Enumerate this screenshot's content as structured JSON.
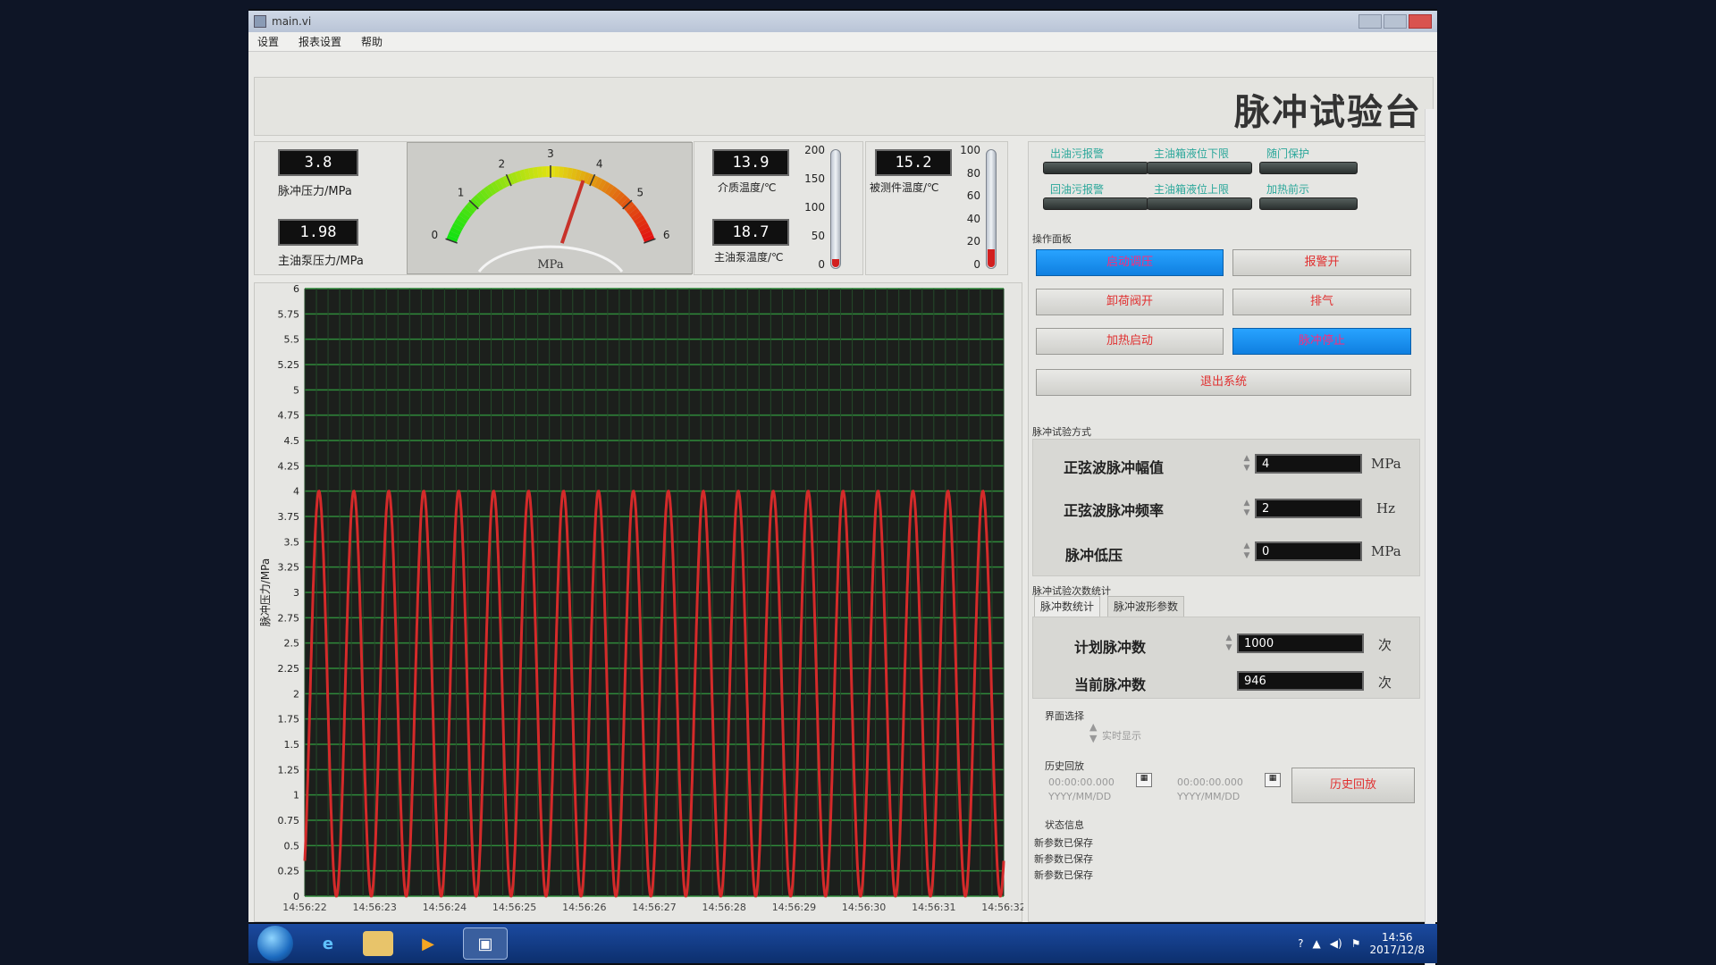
{
  "window": {
    "title": "main.vi"
  },
  "menu": [
    "设置",
    "报表设置",
    "帮助"
  ],
  "banner_title": "脉冲试验台",
  "readouts": {
    "pulse_pressure": {
      "value": "3.8",
      "label": "脉冲压力/MPa"
    },
    "main_pump_pressure": {
      "value": "1.98",
      "label": "主油泵压力/MPa"
    },
    "medium_temp": {
      "value": "13.9",
      "label": "介质温度/℃"
    },
    "main_pump_temp": {
      "value": "18.7",
      "label": "主油泵温度/℃"
    },
    "test_piece_temp": {
      "value": "15.2",
      "label": "被测件温度/℃"
    }
  },
  "gauge": {
    "ticks": [
      "0",
      "1",
      "2",
      "3",
      "4",
      "5",
      "6"
    ],
    "unit": "MPa",
    "value": 3.8,
    "min": 0,
    "max": 6
  },
  "thermo1": {
    "scale": [
      "200",
      "150",
      "100",
      "50",
      "0"
    ],
    "max": 200,
    "value": 13.9
  },
  "thermo2": {
    "scale": [
      "100",
      "80",
      "60",
      "40",
      "20",
      "0"
    ],
    "max": 100,
    "value": 15.2
  },
  "indicators": [
    "出油污报警",
    "主油箱液位下限",
    "随门保护",
    "回油污报警",
    "主油箱液位上限",
    "加热前示"
  ],
  "ops": {
    "title": "操作面板",
    "buttons": [
      "启动调压",
      "报警开",
      "卸荷阀开",
      "排气",
      "加热启动",
      "脉冲停止",
      "退出系统"
    ],
    "active": [
      0,
      5
    ]
  },
  "wave": {
    "title": "脉冲试验方式",
    "amplitude_label": "正弦波脉冲幅值",
    "amplitude_value": "4",
    "amplitude_unit": "MPa",
    "frequency_label": "正弦波脉冲频率",
    "frequency_value": "2",
    "frequency_unit": "Hz",
    "low_label": "脉冲低压",
    "low_value": "0",
    "low_unit": "MPa"
  },
  "count": {
    "title": "脉冲试验次数统计",
    "tabs": [
      "脉冲数统计",
      "脉冲波形参数"
    ],
    "planned_label": "计划脉冲数",
    "planned_value": "1000",
    "current_label": "当前脉冲数",
    "current_value": "946",
    "unit": "次"
  },
  "view": {
    "title": "界面选择",
    "option": "实时显示"
  },
  "history": {
    "title": "历史回放",
    "start_time": "00:00:00.000",
    "start_date": "YYYY/MM/DD",
    "end_time": "00:00:00.000",
    "end_date": "YYYY/MM/DD",
    "button": "历史回放"
  },
  "status": {
    "title": "状态信息",
    "lines": [
      "新参数已保存",
      "新参数已保存",
      "新参数已保存"
    ]
  },
  "taskbar": {
    "time": "14:56",
    "date": "2017/12/8"
  },
  "chart_data": {
    "type": "line",
    "ylabel": "脉冲压力/MPa",
    "ylim": [
      0,
      6
    ],
    "y_ticks": [
      "0",
      "0.25",
      "0.5",
      "0.75",
      "1",
      "1.25",
      "1.5",
      "1.75",
      "2",
      "2.25",
      "2.5",
      "2.75",
      "3",
      "3.25",
      "3.5",
      "3.75",
      "4",
      "4.25",
      "4.5",
      "4.75",
      "5",
      "5.25",
      "5.5",
      "5.75",
      "6"
    ],
    "x_ticks": [
      "14:56:22",
      "14:56:23",
      "14:56:24",
      "14:56:25",
      "14:56:26",
      "14:56:27",
      "14:56:28",
      "14:56:29",
      "14:56:30",
      "14:56:31",
      "14:56:32"
    ],
    "xlim_seconds": [
      0,
      10
    ],
    "series": [
      {
        "amplitude": 4,
        "offset": 0,
        "frequency_hz": 2,
        "color": "#d42a2a"
      }
    ],
    "grid": true,
    "background": "#1c1f1c",
    "grid_color": "#2f8a3a"
  }
}
